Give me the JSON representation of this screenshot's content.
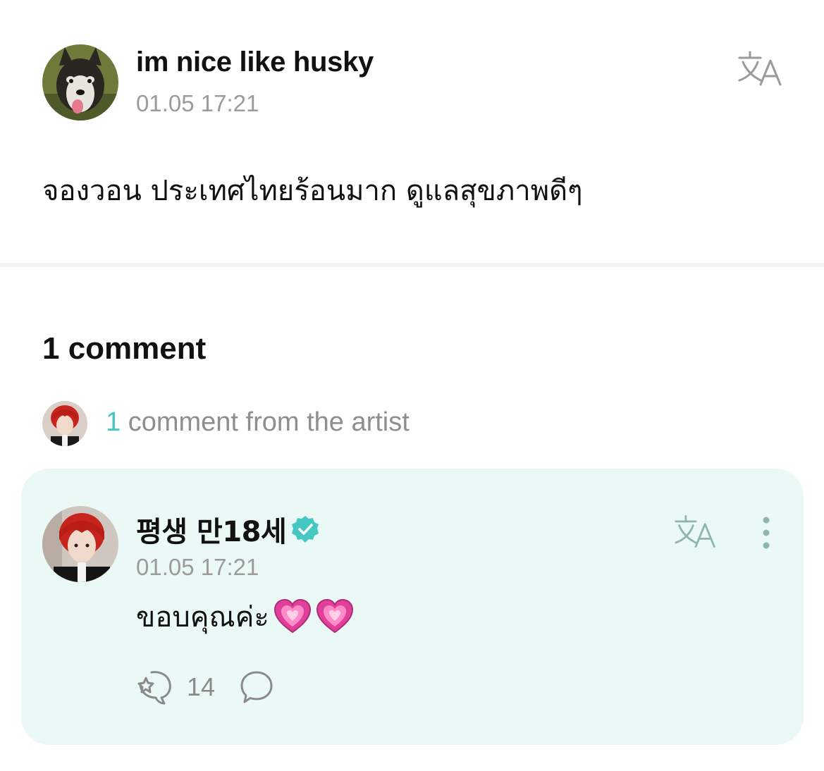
{
  "post": {
    "author": "im nice like husky",
    "time": "01.05 17:21",
    "body": "จองวอน ประเทศไทยร้อนมาก ดูแลสุขภาพดีๆ",
    "translate_icon": "translate-icon"
  },
  "comments": {
    "count_label": "1 comment",
    "artist_summary": {
      "count": "1",
      "label": " comment from the artist"
    }
  },
  "artist_comment": {
    "author": "평생 만18세",
    "verified_icon": "verified-badge-icon",
    "time": "01.05 17:21",
    "text": "ขอบคุณค่ะ",
    "emojis": [
      "heart-emoji",
      "heart-emoji"
    ],
    "like_count": "14",
    "like_icon": "like-icon",
    "reply_icon": "reply-bubble-icon",
    "more_icon": "more-vertical-icon"
  },
  "colors": {
    "accent": "#46c8c2",
    "card_background": "#eaf9f6",
    "muted_text": "#9b9b9b"
  }
}
